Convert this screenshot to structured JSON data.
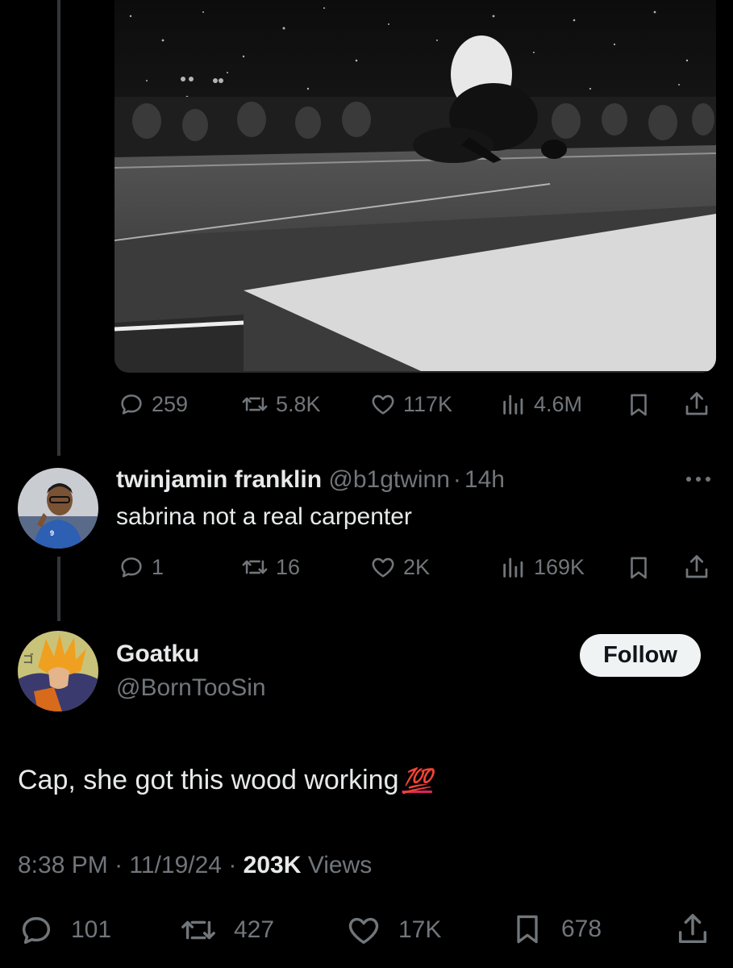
{
  "main_tweet": {
    "image_alt": "",
    "actions": {
      "replies": "259",
      "retweets": "5.8K",
      "likes": "117K",
      "views": "4.6M"
    }
  },
  "reply": {
    "display_name": "twinjamin franklin",
    "handle": "@b1gtwinn",
    "separator": "·",
    "time": "14h",
    "text": "sabrina not a real carpenter",
    "actions": {
      "replies": "1",
      "retweets": "16",
      "likes": "2K",
      "views": "169K"
    }
  },
  "focused_tweet": {
    "display_name": "Goatku",
    "handle": "@BornTooSin",
    "follow_label": "Follow",
    "text": "Cap, she got this wood working",
    "emoji": "💯",
    "time": "8:38 PM",
    "date": "11/19/24",
    "dot": "·",
    "views_count": "203K",
    "views_label": "Views",
    "actions": {
      "replies": "101",
      "retweets": "427",
      "likes": "17K",
      "bookmarks": "678"
    }
  },
  "colors": {
    "background": "#000000",
    "text": "#e7e9ea",
    "muted": "#71767b",
    "line": "#333639",
    "accent_red": "#e0245e"
  },
  "icons": [
    "reply-icon",
    "retweet-icon",
    "like-icon",
    "views-icon",
    "bookmark-icon",
    "share-icon",
    "more-icon"
  ]
}
